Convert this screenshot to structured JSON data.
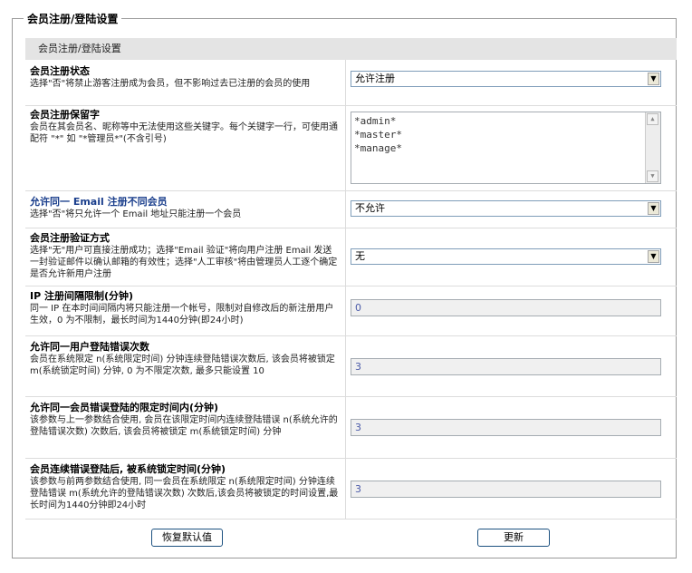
{
  "fieldset_title": "会员注册/登陆设置",
  "panel_header": "会员注册/登陆设置",
  "rows": [
    {
      "title": "会员注册状态",
      "desc": "选择\"否\"将禁止游客注册成为会员，但不影响过去已注册的会员的使用",
      "control": "select",
      "value": "允许注册"
    },
    {
      "title": "会员注册保留字",
      "desc": "会员在其会员名、昵称等中无法使用这些关键字。每个关键字一行，可使用通配符 \"*\" 如 \"*管理员*\"(不含引号)",
      "control": "textarea",
      "lines": [
        "*admin*",
        "*master*",
        "*manage*"
      ]
    },
    {
      "title": "允许同一 Email 注册不同会员",
      "desc": "选择\"否\"将只允许一个 Email 地址只能注册一个会员",
      "control": "select",
      "value": "不允许"
    },
    {
      "title": "会员注册验证方式",
      "desc": "选择\"无\"用户可直接注册成功；选择\"Email 验证\"将向用户注册 Email 发送一封验证邮件以确认邮箱的有效性；选择\"人工审核\"将由管理员人工逐个确定是否允许新用户注册",
      "control": "select",
      "value": "无"
    },
    {
      "title": "IP 注册间隔限制(分钟)",
      "desc": "同一 IP 在本时间间隔内将只能注册一个帐号，限制对自修改后的新注册用户生效，0 为不限制，最长时间为1440分钟(即24小时)",
      "control": "input",
      "value": "0"
    },
    {
      "title": "允许同一用户登陆错误次数",
      "desc": "会员在系统限定 n(系统限定时间) 分钟连续登陆错误次数后, 该会员将被锁定 m(系统锁定时间) 分钟, 0 为不限定次数, 最多只能设置 10",
      "control": "input",
      "value": "3"
    },
    {
      "title": "允许同一会员错误登陆的限定时间内(分钟)",
      "desc": "该参数与上一参数结合使用, 会员在该限定时间内连续登陆错误 n(系统允许的登陆错误次数) 次数后, 该会员将被锁定 m(系统锁定时间) 分钟",
      "control": "input",
      "value": "3"
    },
    {
      "title": "会员连续错误登陆后, 被系统锁定时间(分钟)",
      "desc": "该参数与前两参数结合使用, 同一会员在系统限定 n(系统限定时间) 分钟连续登陆错误 m(系统允许的登陆错误次数) 次数后,该会员将被锁定的时间设置,最长时间为1440分钟即24小时",
      "control": "input",
      "value": "3"
    }
  ],
  "buttons": {
    "reset": "恢复默认值",
    "update": "更新"
  }
}
